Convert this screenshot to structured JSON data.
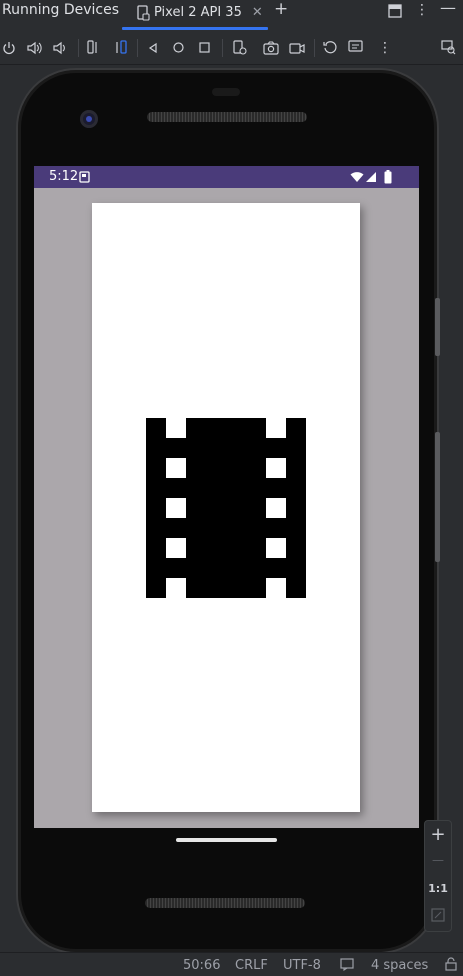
{
  "window": {
    "title": "Running Devices",
    "tab_label": "Pixel 2 API 35"
  },
  "device": {
    "status_time": "5:12"
  },
  "zoom": {
    "plus": "+",
    "minus": "—",
    "one_to_one": "1:1"
  },
  "statusbar": {
    "position": "50:66",
    "line_ending": "CRLF",
    "encoding": "UTF-8",
    "indent": "4 spaces"
  },
  "colors": {
    "accent": "#3574f0",
    "status_bar": "#4a3b7a",
    "screen_bg": "#aba7ab"
  }
}
